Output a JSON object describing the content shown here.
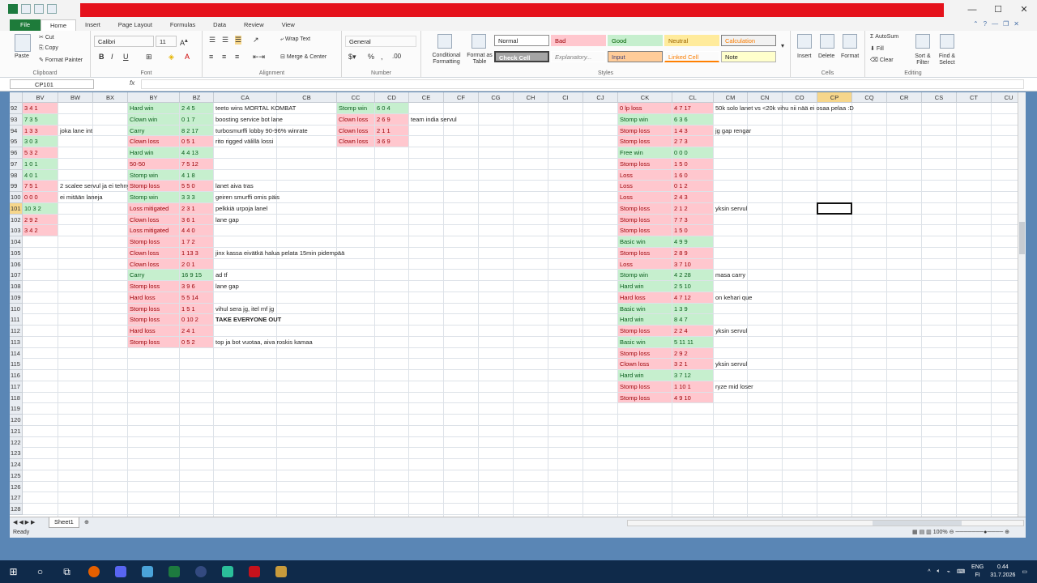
{
  "window": {
    "title": "",
    "minimize": "—",
    "maximize": "☐",
    "close": "✕"
  },
  "tabs": [
    "File",
    "Home",
    "Insert",
    "Page Layout",
    "Formulas",
    "Data",
    "Review",
    "View"
  ],
  "ribbon": {
    "clipboard": {
      "paste": "Paste",
      "cut": "Cut",
      "copy": "Copy",
      "format_painter": "Format Painter",
      "label": "Clipboard"
    },
    "font": {
      "name": "Calibri",
      "size": "11",
      "label": "Font"
    },
    "alignment": {
      "wrap": "Wrap Text",
      "merge": "Merge & Center",
      "label": "Alignment"
    },
    "number": {
      "format": "General",
      "label": "Number"
    },
    "styles": {
      "cond": "Conditional Formatting",
      "table": "Format as Table",
      "normal": "Normal",
      "bad": "Bad",
      "good": "Good",
      "neutral": "Neutral",
      "calculation": "Calculation",
      "check": "Check Cell",
      "explanatory": "Explanatory...",
      "input": "Input",
      "linked": "Linked Cell",
      "note": "Note",
      "label": "Styles"
    },
    "cells": {
      "insert": "Insert",
      "delete": "Delete",
      "format": "Format",
      "label": "Cells"
    },
    "editing": {
      "autosum": "AutoSum",
      "fill": "Fill",
      "clear": "Clear",
      "sort": "Sort & Filter",
      "find": "Find & Select",
      "label": "Editing"
    }
  },
  "formula_bar": {
    "name_box": "CP101",
    "fx": "fx",
    "value": ""
  },
  "columns": [
    "BV",
    "BW",
    "BX",
    "BY",
    "BZ",
    "CA",
    "CB",
    "CC",
    "CD",
    "CE",
    "CF",
    "CG",
    "CH",
    "CI",
    "CJ",
    "CK",
    "CL",
    "CM",
    "CN",
    "CO",
    "CP",
    "CQ",
    "CR",
    "CS",
    "CT",
    "CU",
    "CV"
  ],
  "rows": [
    "92",
    "93",
    "94",
    "95",
    "96",
    "97",
    "98",
    "99",
    "100",
    "101",
    "102",
    "103",
    "104",
    "105",
    "106",
    "107",
    "108",
    "109",
    "110",
    "111",
    "112",
    "113",
    "114",
    "115",
    "116",
    "117",
    "118",
    "119",
    "120",
    "121",
    "122",
    "123",
    "124",
    "125",
    "126",
    "127",
    "128"
  ],
  "cells": [
    {
      "r": 0,
      "c": "BV",
      "t": "3 4 1",
      "s": "r"
    },
    {
      "r": 0,
      "c": "BY",
      "t": "Hard win",
      "s": "g"
    },
    {
      "r": 0,
      "c": "BZ",
      "t": "2 4 5",
      "s": "g"
    },
    {
      "r": 0,
      "c": "CA",
      "t": "teeto wins MORTAL KOMBAT",
      "s": ""
    },
    {
      "r": 0,
      "c": "CC",
      "t": "Stomp win",
      "s": "g"
    },
    {
      "r": 0,
      "c": "CD",
      "t": "6 0 4",
      "s": "g"
    },
    {
      "r": 0,
      "c": "CK",
      "t": "0 lp loss",
      "s": "r"
    },
    {
      "r": 0,
      "c": "CL",
      "t": "4 7 17",
      "s": "r"
    },
    {
      "r": 0,
      "c": "CM",
      "t": "50k solo lanet vs <20k vihu nii nää ei osaa pelaa :D",
      "s": ""
    },
    {
      "r": 1,
      "c": "BV",
      "t": "7 3 5",
      "s": "g"
    },
    {
      "r": 1,
      "c": "BY",
      "t": "Clown win",
      "s": "g"
    },
    {
      "r": 1,
      "c": "BZ",
      "t": "0 1 7",
      "s": "g"
    },
    {
      "r": 1,
      "c": "CA",
      "t": "boosting service bot lane",
      "s": ""
    },
    {
      "r": 1,
      "c": "CC",
      "t": "Clown loss",
      "s": "r"
    },
    {
      "r": 1,
      "c": "CD",
      "t": "2 6 9",
      "s": "r"
    },
    {
      "r": 1,
      "c": "CE",
      "t": "team india servul",
      "s": ""
    },
    {
      "r": 1,
      "c": "CK",
      "t": "Stomp win",
      "s": "g"
    },
    {
      "r": 1,
      "c": "CL",
      "t": "6 3 6",
      "s": "g"
    },
    {
      "r": 2,
      "c": "BV",
      "t": "1 3 3",
      "s": "r"
    },
    {
      "r": 2,
      "c": "BW",
      "t": "joka lane int",
      "s": ""
    },
    {
      "r": 2,
      "c": "BY",
      "t": "Carry",
      "s": "g"
    },
    {
      "r": 2,
      "c": "BZ",
      "t": "8 2 17",
      "s": "g"
    },
    {
      "r": 2,
      "c": "CA",
      "t": "turbosmurffi lobby 90-96% winrate",
      "s": ""
    },
    {
      "r": 2,
      "c": "CC",
      "t": "Clown loss",
      "s": "r"
    },
    {
      "r": 2,
      "c": "CD",
      "t": "2 1 1",
      "s": "r"
    },
    {
      "r": 2,
      "c": "CK",
      "t": "Stomp loss",
      "s": "r"
    },
    {
      "r": 2,
      "c": "CL",
      "t": "1 4 3",
      "s": "r"
    },
    {
      "r": 2,
      "c": "CM",
      "t": "jg gap rengar",
      "s": ""
    },
    {
      "r": 3,
      "c": "BV",
      "t": "3 0 3",
      "s": "g"
    },
    {
      "r": 3,
      "c": "BY",
      "t": "Clown loss",
      "s": "r"
    },
    {
      "r": 3,
      "c": "BZ",
      "t": "0 5 1",
      "s": "r"
    },
    {
      "r": 3,
      "c": "CA",
      "t": "rito rigged välillä lossi",
      "s": ""
    },
    {
      "r": 3,
      "c": "CC",
      "t": "Clown loss",
      "s": "r"
    },
    {
      "r": 3,
      "c": "CD",
      "t": "3 6 9",
      "s": "r"
    },
    {
      "r": 3,
      "c": "CK",
      "t": "Stomp loss",
      "s": "r"
    },
    {
      "r": 3,
      "c": "CL",
      "t": "2 7 3",
      "s": "r"
    },
    {
      "r": 4,
      "c": "BV",
      "t": "5 3 2",
      "s": "r"
    },
    {
      "r": 4,
      "c": "BY",
      "t": "Hard win",
      "s": "g"
    },
    {
      "r": 4,
      "c": "BZ",
      "t": "4 4 13",
      "s": "g"
    },
    {
      "r": 4,
      "c": "CK",
      "t": "Free win",
      "s": "g"
    },
    {
      "r": 4,
      "c": "CL",
      "t": "0 0 0",
      "s": "g"
    },
    {
      "r": 5,
      "c": "BV",
      "t": "1 0 1",
      "s": "g"
    },
    {
      "r": 5,
      "c": "BY",
      "t": "50-50",
      "s": "r"
    },
    {
      "r": 5,
      "c": "BZ",
      "t": "7 5 12",
      "s": "r"
    },
    {
      "r": 5,
      "c": "CK",
      "t": "Stomp loss",
      "s": "r"
    },
    {
      "r": 5,
      "c": "CL",
      "t": "1 5 0",
      "s": "r"
    },
    {
      "r": 6,
      "c": "BV",
      "t": "4 0 1",
      "s": "g"
    },
    {
      "r": 6,
      "c": "BY",
      "t": "Stomp win",
      "s": "g"
    },
    {
      "r": 6,
      "c": "BZ",
      "t": "4 1 8",
      "s": "g"
    },
    {
      "r": 6,
      "c": "CK",
      "t": "Loss",
      "s": "r"
    },
    {
      "r": 6,
      "c": "CL",
      "t": "1 6 0",
      "s": "r"
    },
    {
      "r": 7,
      "c": "BV",
      "t": "7 5 1",
      "s": "r"
    },
    {
      "r": 7,
      "c": "BW",
      "t": "2 scalee servul ja ei tehny",
      "s": ""
    },
    {
      "r": 7,
      "c": "BY",
      "t": "Stomp loss",
      "s": "r"
    },
    {
      "r": 7,
      "c": "BZ",
      "t": "5 5 0",
      "s": "r"
    },
    {
      "r": 7,
      "c": "CA",
      "t": "lanet aiva tras",
      "s": ""
    },
    {
      "r": 7,
      "c": "CK",
      "t": "Loss",
      "s": "r"
    },
    {
      "r": 7,
      "c": "CL",
      "t": "0 1 2",
      "s": "r"
    },
    {
      "r": 8,
      "c": "BV",
      "t": "0 0 0",
      "s": "r"
    },
    {
      "r": 8,
      "c": "BW",
      "t": "ei mitään laneja",
      "s": ""
    },
    {
      "r": 8,
      "c": "BY",
      "t": "Stomp win",
      "s": "g"
    },
    {
      "r": 8,
      "c": "BZ",
      "t": "3 3 3",
      "s": "g"
    },
    {
      "r": 8,
      "c": "CA",
      "t": "geiren smurffi omis päis",
      "s": ""
    },
    {
      "r": 8,
      "c": "CK",
      "t": "Loss",
      "s": "r"
    },
    {
      "r": 8,
      "c": "CL",
      "t": "2 4 3",
      "s": "r"
    },
    {
      "r": 9,
      "c": "BV",
      "t": "10 3 2",
      "s": "g"
    },
    {
      "r": 9,
      "c": "BY",
      "t": "Loss mitigated",
      "s": "r"
    },
    {
      "r": 9,
      "c": "BZ",
      "t": "2 3 1",
      "s": "r"
    },
    {
      "r": 9,
      "c": "CA",
      "t": "pelkkiä urpoja lanel",
      "s": ""
    },
    {
      "r": 9,
      "c": "CK",
      "t": "Stomp loss",
      "s": "r"
    },
    {
      "r": 9,
      "c": "CL",
      "t": "2 1 2",
      "s": "r"
    },
    {
      "r": 9,
      "c": "CM",
      "t": "yksin servul",
      "s": ""
    },
    {
      "r": 10,
      "c": "BV",
      "t": "2 9 2",
      "s": "r"
    },
    {
      "r": 10,
      "c": "BY",
      "t": "Clown loss",
      "s": "r"
    },
    {
      "r": 10,
      "c": "BZ",
      "t": "3 6 1",
      "s": "r"
    },
    {
      "r": 10,
      "c": "CA",
      "t": "lane gap",
      "s": ""
    },
    {
      "r": 10,
      "c": "CK",
      "t": "Stomp loss",
      "s": "r"
    },
    {
      "r": 10,
      "c": "CL",
      "t": "7 7 3",
      "s": "r"
    },
    {
      "r": 11,
      "c": "BV",
      "t": "3 4 2",
      "s": "r"
    },
    {
      "r": 11,
      "c": "BY",
      "t": "Loss mitigated",
      "s": "r"
    },
    {
      "r": 11,
      "c": "BZ",
      "t": "4 4 0",
      "s": "r"
    },
    {
      "r": 11,
      "c": "CK",
      "t": "Stomp loss",
      "s": "r"
    },
    {
      "r": 11,
      "c": "CL",
      "t": "1 5 0",
      "s": "r"
    },
    {
      "r": 12,
      "c": "BY",
      "t": "Stomp loss",
      "s": "r"
    },
    {
      "r": 12,
      "c": "BZ",
      "t": "1 7 2",
      "s": "r"
    },
    {
      "r": 12,
      "c": "CK",
      "t": "Basic win",
      "s": "g"
    },
    {
      "r": 12,
      "c": "CL",
      "t": "4 9 9",
      "s": "g"
    },
    {
      "r": 13,
      "c": "BY",
      "t": "Clown loss",
      "s": "r"
    },
    {
      "r": 13,
      "c": "BZ",
      "t": "1 13 3",
      "s": "r"
    },
    {
      "r": 13,
      "c": "CA",
      "t": "jinx kassa eivätkä halua pelata 15min pidempää",
      "s": ""
    },
    {
      "r": 13,
      "c": "CK",
      "t": "Stomp loss",
      "s": "r"
    },
    {
      "r": 13,
      "c": "CL",
      "t": "2 8 9",
      "s": "r"
    },
    {
      "r": 14,
      "c": "BY",
      "t": "Clown loss",
      "s": "r"
    },
    {
      "r": 14,
      "c": "BZ",
      "t": "2 0 1",
      "s": "r"
    },
    {
      "r": 14,
      "c": "CK",
      "t": "Loss",
      "s": "r"
    },
    {
      "r": 14,
      "c": "CL",
      "t": "3 7 10",
      "s": "r"
    },
    {
      "r": 15,
      "c": "BY",
      "t": "Carry",
      "s": "g"
    },
    {
      "r": 15,
      "c": "BZ",
      "t": "16 9 15",
      "s": "g"
    },
    {
      "r": 15,
      "c": "CA",
      "t": "ad tf",
      "s": ""
    },
    {
      "r": 15,
      "c": "CK",
      "t": "Stomp win",
      "s": "g"
    },
    {
      "r": 15,
      "c": "CL",
      "t": "4 2 28",
      "s": "g"
    },
    {
      "r": 15,
      "c": "CM",
      "t": "masa carry",
      "s": ""
    },
    {
      "r": 16,
      "c": "BY",
      "t": "Stomp loss",
      "s": "r"
    },
    {
      "r": 16,
      "c": "BZ",
      "t": "3 9 6",
      "s": "r"
    },
    {
      "r": 16,
      "c": "CA",
      "t": "lane gap",
      "s": ""
    },
    {
      "r": 16,
      "c": "CK",
      "t": "Hard win",
      "s": "g"
    },
    {
      "r": 16,
      "c": "CL",
      "t": "2 5 10",
      "s": "g"
    },
    {
      "r": 17,
      "c": "BY",
      "t": "Hard loss",
      "s": "r"
    },
    {
      "r": 17,
      "c": "BZ",
      "t": "5 5 14",
      "s": "r"
    },
    {
      "r": 17,
      "c": "CK",
      "t": "Hard loss",
      "s": "r"
    },
    {
      "r": 17,
      "c": "CL",
      "t": "4 7 12",
      "s": "r"
    },
    {
      "r": 17,
      "c": "CM",
      "t": "on kehari que",
      "s": ""
    },
    {
      "r": 18,
      "c": "BY",
      "t": "Stomp loss",
      "s": "r"
    },
    {
      "r": 18,
      "c": "BZ",
      "t": "1 5 1",
      "s": "r"
    },
    {
      "r": 18,
      "c": "CA",
      "t": "vihul sera jg, itel mf jg",
      "s": ""
    },
    {
      "r": 18,
      "c": "CK",
      "t": "Basic win",
      "s": "g"
    },
    {
      "r": 18,
      "c": "CL",
      "t": "1 3 9",
      "s": "g"
    },
    {
      "r": 19,
      "c": "BY",
      "t": "Stomp loss",
      "s": "r"
    },
    {
      "r": 19,
      "c": "BZ",
      "t": "0 10 2",
      "s": "r"
    },
    {
      "r": 19,
      "c": "CA",
      "t": "TAKE EVERYONE OUT",
      "s": "b"
    },
    {
      "r": 19,
      "c": "CK",
      "t": "Hard win",
      "s": "g"
    },
    {
      "r": 19,
      "c": "CL",
      "t": "8 4 7",
      "s": "g"
    },
    {
      "r": 20,
      "c": "BY",
      "t": "Hard loss",
      "s": "r"
    },
    {
      "r": 20,
      "c": "BZ",
      "t": "2 4 1",
      "s": "r"
    },
    {
      "r": 20,
      "c": "CK",
      "t": "Stomp loss",
      "s": "r"
    },
    {
      "r": 20,
      "c": "CL",
      "t": "2 2 4",
      "s": "r"
    },
    {
      "r": 20,
      "c": "CM",
      "t": "yksin servul",
      "s": ""
    },
    {
      "r": 21,
      "c": "BY",
      "t": "Stomp loss",
      "s": "r"
    },
    {
      "r": 21,
      "c": "BZ",
      "t": "0 5 2",
      "s": "r"
    },
    {
      "r": 21,
      "c": "CA",
      "t": "top ja bot vuotaa, aiva roskis kamaa",
      "s": ""
    },
    {
      "r": 21,
      "c": "CK",
      "t": "Basic win",
      "s": "g"
    },
    {
      "r": 21,
      "c": "CL",
      "t": "5 11 11",
      "s": "g"
    },
    {
      "r": 22,
      "c": "CK",
      "t": "Stomp loss",
      "s": "r"
    },
    {
      "r": 22,
      "c": "CL",
      "t": "2 9 2",
      "s": "r"
    },
    {
      "r": 23,
      "c": "CK",
      "t": "Clown loss",
      "s": "r"
    },
    {
      "r": 23,
      "c": "CL",
      "t": "3 2 1",
      "s": "r"
    },
    {
      "r": 23,
      "c": "CM",
      "t": "yksin servul",
      "s": ""
    },
    {
      "r": 24,
      "c": "CK",
      "t": "Hard win",
      "s": "g"
    },
    {
      "r": 24,
      "c": "CL",
      "t": "3 7 12",
      "s": "g"
    },
    {
      "r": 25,
      "c": "CK",
      "t": "Stomp loss",
      "s": "r"
    },
    {
      "r": 25,
      "c": "CL",
      "t": "1 10 1",
      "s": "r"
    },
    {
      "r": 25,
      "c": "CM",
      "t": "ryze mid loser",
      "s": ""
    },
    {
      "r": 26,
      "c": "CK",
      "t": "Stomp loss",
      "s": "r"
    },
    {
      "r": 26,
      "c": "CL",
      "t": "4 9 10",
      "s": "r"
    }
  ],
  "selected": {
    "col": "CP",
    "row": "101"
  },
  "sheet_tab": "Sheet1",
  "status": {
    "ready": "Ready",
    "zoom": "100%"
  },
  "taskbar": {
    "lang": "ENG",
    "locale": "FI",
    "time": "0.44",
    "date": "31.7.2026"
  }
}
